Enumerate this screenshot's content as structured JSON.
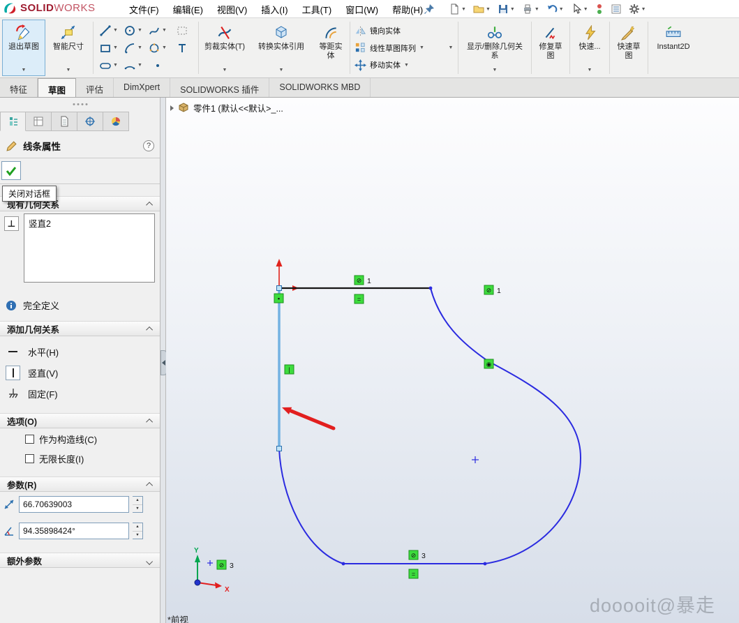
{
  "menubar": {
    "logo": {
      "solid": "SOLID",
      "works": "WORKS"
    },
    "menus": [
      "文件(F)",
      "编辑(E)",
      "视图(V)",
      "插入(I)",
      "工具(T)",
      "窗口(W)",
      "帮助(H)"
    ],
    "quick_access_icons": [
      "new-document",
      "open-folder",
      "save",
      "print",
      "undo",
      "select-cursor",
      "status-lights",
      "task-list",
      "options-gear",
      "pin"
    ]
  },
  "ribbon": {
    "exit_sketch": "退出草图",
    "smart_dimension": "智能尺寸",
    "trim_entities": "剪裁实体(T)",
    "convert_entities": "转换实体引用",
    "offset_entities": "等距实体",
    "mirror_entities": "镜向实体",
    "linear_sketch_pattern": "线性草图阵列",
    "move_entities": "移动实体",
    "display_delete_relations": "显示/删除几何关系",
    "repair_sketch": "修复草图",
    "quick_snaps": "快速...",
    "rapid_sketch": "快速草图",
    "instant2d": "Instant2D",
    "sketch_tool_icons": [
      "line",
      "circle",
      "spline",
      "construction-rect",
      "corner-rectangle",
      "arc",
      "perimeter-circle",
      "text",
      "slot",
      "three-point-arc",
      "point"
    ]
  },
  "command_tabs": {
    "tabs": [
      "特征",
      "草图",
      "评估",
      "DimXpert",
      "SOLIDWORKS 插件",
      "SOLIDWORKS MBD"
    ],
    "active": "草图"
  },
  "view_toolbar_icons": [
    "zoom-fit",
    "zoom-area",
    "section-view",
    "view-orientation",
    "display-style",
    "edit-appearance",
    "apply-scene"
  ],
  "property_manager": {
    "title": "线条属性",
    "help": "?",
    "ok_tooltip": "关闭对话框",
    "existing_relations": {
      "header": "现有几何关系",
      "items": [
        "竖直2"
      ]
    },
    "status": "完全定义",
    "add_relations": {
      "header": "添加几何关系",
      "horizontal": "水平(H)",
      "vertical": "竖直(V)",
      "fix": "固定(F)"
    },
    "options": {
      "header": "选项(O)",
      "construction": "作为构造线(C)",
      "infinite": "无限长度(I)"
    },
    "parameters": {
      "header": "参数(R)",
      "length": "66.70639003",
      "angle": "94.35898424°"
    },
    "additional_parameters": {
      "header": "额外参数"
    },
    "tab_icons": [
      "feature-tree",
      "configuration",
      "page",
      "dimxpert-target",
      "display-pie"
    ]
  },
  "graphics": {
    "feature_tree_label": "零件1 (默认<<默认>_...",
    "relation_markers": [
      {
        "name": "tangent-1-on-line",
        "glyph": "⊘",
        "label": "1"
      },
      {
        "name": "equal-top",
        "glyph": "=",
        "label": ""
      },
      {
        "name": "tangent-1-on-arc",
        "glyph": "⊘",
        "label": "1"
      },
      {
        "name": "tangent-mid-curve",
        "glyph": "◉",
        "label": ""
      },
      {
        "name": "coincident-top",
        "glyph": "▪",
        "label": ""
      },
      {
        "name": "vertical-on-line",
        "glyph": "|",
        "label": ""
      },
      {
        "name": "tangent-3-on-line",
        "glyph": "⊘",
        "label": "3"
      },
      {
        "name": "equal-bottom",
        "glyph": "=",
        "label": ""
      },
      {
        "name": "tangent-3-near-triad",
        "glyph": "⊘",
        "label": "3"
      }
    ],
    "triad": {
      "x": "X",
      "y": "Y"
    },
    "watermark": "dooooit@暴走",
    "view_label": "*前视"
  }
}
